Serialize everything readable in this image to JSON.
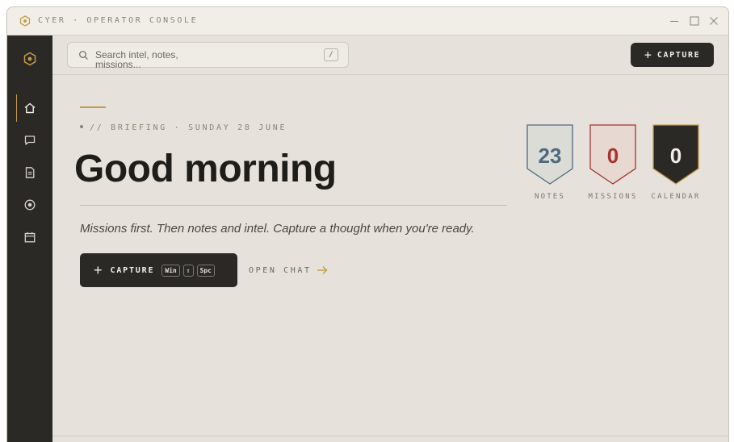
{
  "window": {
    "title": "CYER · OPERATOR CONSOLE",
    "accent_color": "#c49a4a",
    "rail_color": "#2a2925",
    "icons": [
      "app-hexagon-icon",
      "minimize-icon",
      "maximize-icon",
      "close-icon"
    ]
  },
  "sidebar": {
    "items": [
      {
        "name": "home",
        "icon": "home-icon",
        "active": true
      },
      {
        "name": "chat",
        "icon": "chat-bubble-icon",
        "active": false
      },
      {
        "name": "notes",
        "icon": "document-icon",
        "active": false
      },
      {
        "name": "missions",
        "icon": "target-icon",
        "active": false
      },
      {
        "name": "calendar",
        "icon": "calendar-icon",
        "active": false
      }
    ]
  },
  "topbar": {
    "search_placeholder": "Search intel, notes, missions...",
    "search_shortcut": "/",
    "capture_label": "CAPTURE"
  },
  "briefing": {
    "eyebrow": "// BRIEFING · SUNDAY 28 JUNE",
    "greeting": "Good morning",
    "tagline": "Missions first. Then notes and intel. Capture a thought when you're ready.",
    "capture_label": "CAPTURE",
    "shortcut_keys": [
      "Win",
      "⇧",
      "Spc"
    ],
    "open_chat_label": "OPEN CHAT"
  },
  "stats": [
    {
      "label": "NOTES",
      "value": "23",
      "color": "#4f6a80",
      "fill": "#dcdcd6"
    },
    {
      "label": "MISSIONS",
      "value": "0",
      "color": "#a3352e",
      "fill": "#e7d8d2"
    },
    {
      "label": "CALENDAR",
      "value": "0",
      "color": "#f1eee8",
      "fill": "#2a2925"
    }
  ]
}
